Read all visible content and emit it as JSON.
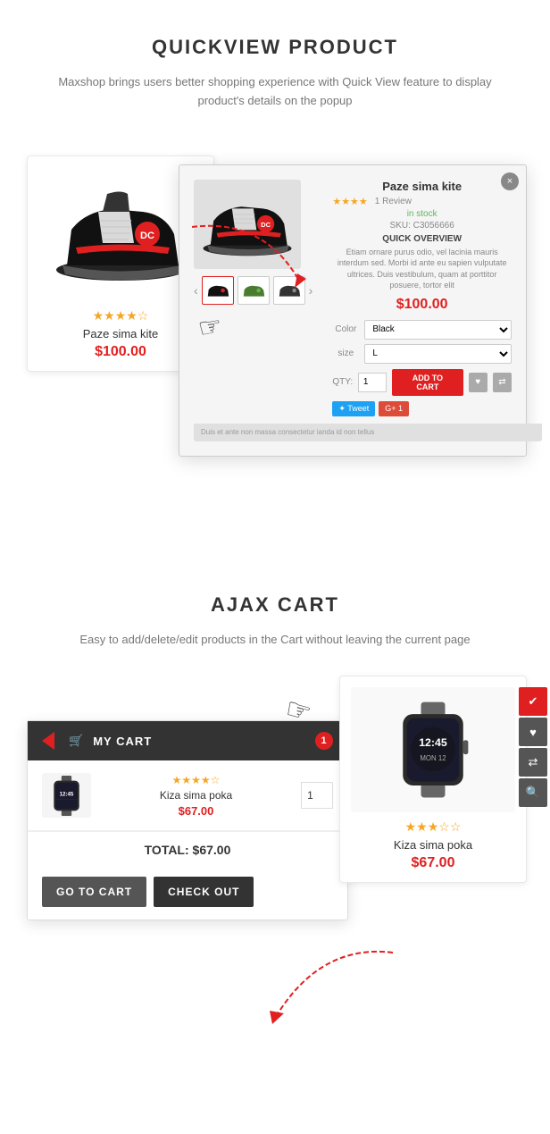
{
  "quickview": {
    "title": "QUICKVIEW PRODUCT",
    "description": "Maxshop brings users better shopping experience with Quick View feature to display product's details on the popup",
    "product": {
      "name": "Paze sima kite",
      "price": "$100.00",
      "stars": 4,
      "max_stars": 5
    },
    "popup": {
      "product_name": "Paze sima kite",
      "stars": 4,
      "review_count": "1 Review",
      "in_stock": "in stock",
      "sku": "SKU: C3056666",
      "overview_title": "QUICK OVERVIEW",
      "overview_text": "Etiam ornare purus odio, vel lacinia mauris interdum sed. Morbi id ante eu sapien vulputate ultrices. Duis vestibulum, quam at porttitor posuere, tortor elit",
      "price": "$100.00",
      "color_label": "Color",
      "color_value": "Black",
      "size_label": "size",
      "size_value": "L",
      "qty_label": "QTY:",
      "qty_value": "1",
      "add_to_cart": "ADD TO CART",
      "close_label": "×"
    }
  },
  "ajax_cart": {
    "title": "AJAX CART",
    "description": "Easy to add/delete/edit products in the Cart without leaving the current page",
    "cart_header": "MY CART",
    "cart_count": "1",
    "item": {
      "name": "Kiza sima poka",
      "price": "$67.00",
      "stars": 4,
      "qty": "1"
    },
    "total_label": "TOTAL:",
    "total_value": "$67.00",
    "go_to_cart": "GO TO CART",
    "check_out": "CHECK OUT"
  },
  "product_card2": {
    "name": "Kiza sima poka",
    "price": "$67.00",
    "stars": 3
  },
  "icons": {
    "cart": "🛒",
    "heart": "♥",
    "compare": "⇄",
    "quickview": "🔍",
    "hand_cursor": "👆",
    "tweet": "Tweet",
    "gplus": "G+ 1"
  }
}
